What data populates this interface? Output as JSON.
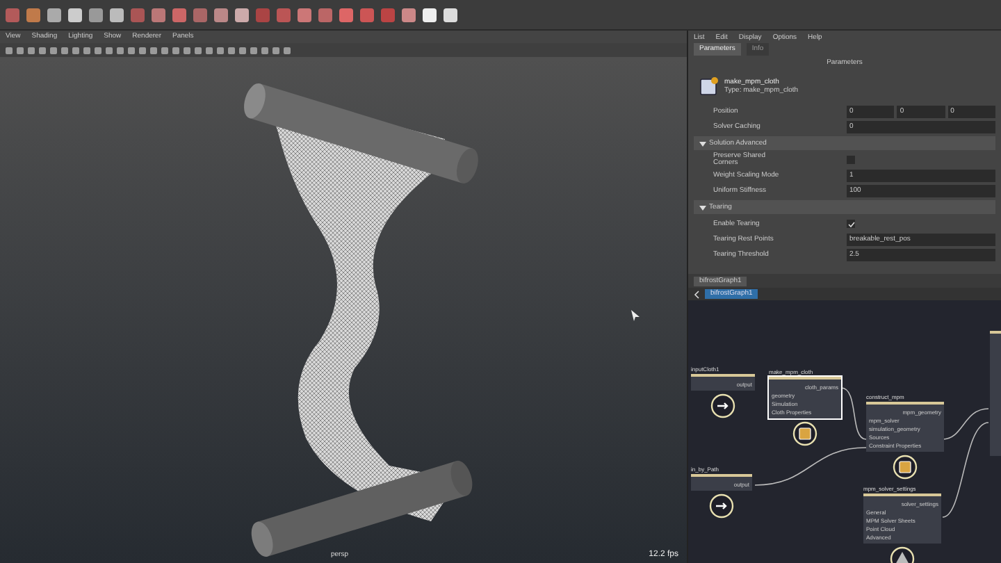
{
  "viewport": {
    "menu": [
      "View",
      "Shading",
      "Lighting",
      "Show",
      "Renderer",
      "Panels"
    ],
    "camera": "persp",
    "fps": "12.2 fps"
  },
  "attribute_editor": {
    "menu": [
      "List",
      "Edit",
      "Display",
      "Options",
      "Help"
    ],
    "tabs": [
      {
        "label": "Parameters",
        "selected": true
      },
      {
        "label": "Info",
        "selected": false
      }
    ],
    "heading": "Parameters",
    "node_name": "make_mpm_cloth",
    "node_type": "Type: make_mpm_cloth",
    "rows": [
      {
        "kind": "vector",
        "label": "Position",
        "values": [
          "0",
          "0",
          "0"
        ]
      },
      {
        "kind": "number",
        "label": "Solver Caching",
        "value": "0"
      },
      {
        "kind": "section",
        "label": "Solution Advanced",
        "expanded": true
      },
      {
        "kind": "checkbox",
        "label": "Preserve Shared Corners",
        "checked": false
      },
      {
        "kind": "number",
        "label": "Weight Scaling Mode",
        "value": "1"
      },
      {
        "kind": "number",
        "label": "Uniform Stiffness",
        "value": "100"
      },
      {
        "kind": "section",
        "label": "Tearing",
        "expanded": true
      },
      {
        "kind": "checkbox",
        "label": "Enable Tearing",
        "checked": true
      },
      {
        "kind": "text",
        "label": "Tearing Rest Points",
        "value": "breakable_rest_pos"
      },
      {
        "kind": "number",
        "label": "Tearing Threshold",
        "value": "2.5"
      }
    ]
  },
  "graph": {
    "tab": "bifrostGraph1",
    "breadcrumb": "bifrostGraph1",
    "nodes": [
      {
        "kind": "input",
        "title": "inputCloth1",
        "output": "output",
        "selected": false
      },
      {
        "kind": "compound",
        "title": "make_mpm_cloth",
        "inputs": [
          "geometry",
          "Simulation",
          "Cloth Properties"
        ],
        "output": "cloth_params",
        "selected": true
      },
      {
        "kind": "compound",
        "title": "construct_mpm",
        "inputs": [
          "mpm_solver",
          "simulation_geometry",
          "Sources",
          "Constraint Properties"
        ],
        "output": "mpm_geometry",
        "selected": false
      },
      {
        "kind": "input",
        "title": "in_by_Path",
        "output": "output",
        "selected": false
      },
      {
        "kind": "settings",
        "title": "mpm_solver_settings",
        "inputs": [
          "General",
          "MPM Solver Sheets",
          "Point Cloud",
          "Advanced"
        ],
        "output": "solver_settings",
        "selected": false
      }
    ]
  }
}
